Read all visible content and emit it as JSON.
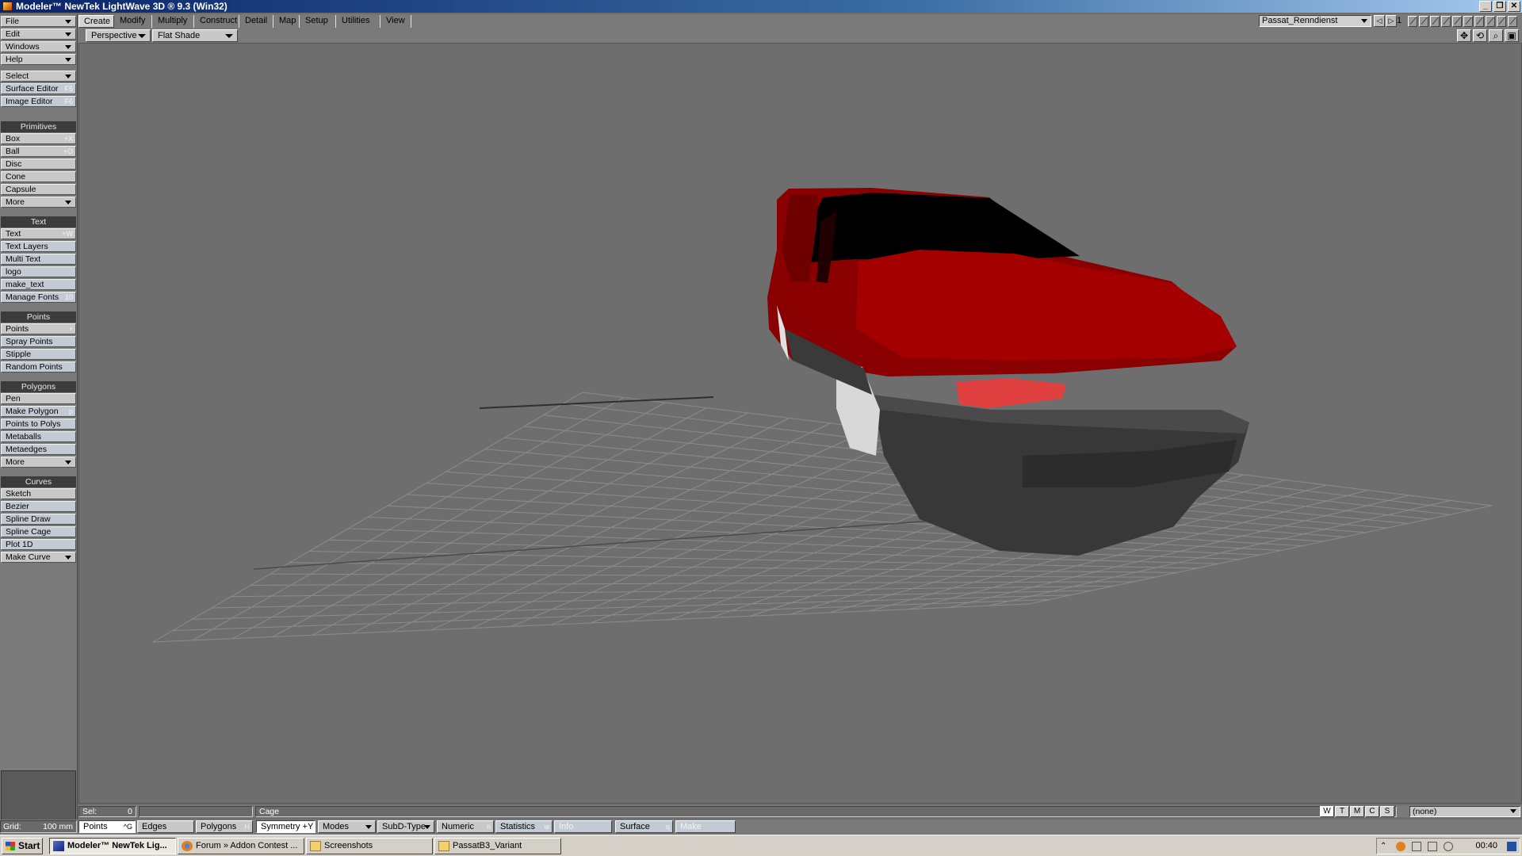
{
  "window": {
    "title": "Modeler™ NewTek LightWave 3D ® 9.3 (Win32)"
  },
  "left_panel": {
    "menus": [
      "File",
      "Edit",
      "Windows",
      "Help"
    ],
    "select": "Select",
    "surface_editor": {
      "label": "Surface Editor",
      "key": "F5"
    },
    "image_editor": {
      "label": "Image Editor",
      "key": "F6"
    },
    "primitives": {
      "header": "Primitives",
      "items": [
        {
          "label": "Box",
          "key": "+X"
        },
        {
          "label": "Ball",
          "key": "+O"
        },
        {
          "label": "Disc",
          "key": ""
        },
        {
          "label": "Cone",
          "key": ""
        },
        {
          "label": "Capsule",
          "key": ""
        },
        {
          "label": "More",
          "key": ""
        }
      ]
    },
    "text": {
      "header": "Text",
      "items": [
        {
          "label": "Text",
          "key": "+W"
        },
        {
          "label": "Text Layers",
          "key": ""
        },
        {
          "label": "Multi Text",
          "key": ""
        },
        {
          "label": "logo",
          "key": ""
        },
        {
          "label": "make_text",
          "key": ""
        },
        {
          "label": "Manage Fonts",
          "key": "10"
        }
      ]
    },
    "points": {
      "header": "Points",
      "items": [
        {
          "label": "Points",
          "key": "+"
        },
        {
          "label": "Spray Points",
          "key": ""
        },
        {
          "label": "Stipple",
          "key": ""
        },
        {
          "label": "Random Points",
          "key": ""
        }
      ]
    },
    "polygons": {
      "header": "Polygons",
      "items": [
        {
          "label": "Pen",
          "key": ""
        },
        {
          "label": "Make Polygon",
          "key": "p"
        },
        {
          "label": "Points to Polys",
          "key": ""
        },
        {
          "label": "Metaballs",
          "key": ""
        },
        {
          "label": "Metaedges",
          "key": ""
        },
        {
          "label": "More",
          "key": ""
        }
      ]
    },
    "curves": {
      "header": "Curves",
      "items": [
        {
          "label": "Sketch",
          "key": ""
        },
        {
          "label": "Bezier",
          "key": ""
        },
        {
          "label": "Spline Draw",
          "key": ""
        },
        {
          "label": "Spline Cage",
          "key": ""
        },
        {
          "label": "Plot 1D",
          "key": ""
        },
        {
          "label": "Make Curve",
          "key": ""
        }
      ]
    }
  },
  "tabs": [
    "Create",
    "Modify",
    "Multiply",
    "Construct",
    "Detail",
    "Map",
    "Setup",
    "Utilities",
    "View"
  ],
  "scene": {
    "object": "Passat_Renndienst",
    "layer": "1"
  },
  "viewport": {
    "view": "Perspective",
    "shading": "Flat Shade"
  },
  "info": {
    "sel_label": "Sel:",
    "sel_count": "0",
    "cage": "Cage",
    "wtmcs": [
      "W",
      "T",
      "M",
      "C",
      "S"
    ],
    "surface_select": "(none)"
  },
  "mode_bar": {
    "grid_label": "Grid:",
    "grid_value": "100 mm",
    "points": {
      "label": "Points",
      "key": "^G"
    },
    "edges": "Edges",
    "polygons": {
      "label": "Polygons",
      "key": "H"
    },
    "symmetry": "Symmetry +Y",
    "modes": "Modes",
    "subd_type": "SubD-Type",
    "numeric": {
      "label": "Numeric",
      "key": "n"
    },
    "statistics": {
      "label": "Statistics",
      "key": "w"
    },
    "info": "Info",
    "surface": {
      "label": "Surface",
      "key": "q"
    },
    "make": "Make"
  },
  "taskbar": {
    "start": "Start",
    "tasks": [
      "Modeler™ NewTek Lig...",
      "Forum » Addon Contest ...",
      "Screenshots",
      "PassatB3_Variant"
    ],
    "clock": "00:40"
  },
  "colors": {
    "car_body": "#8a0000",
    "bumper": "#3a3a3a",
    "viewport_bg": "#6e6e6e",
    "grid_line": "#8c8c8c"
  }
}
